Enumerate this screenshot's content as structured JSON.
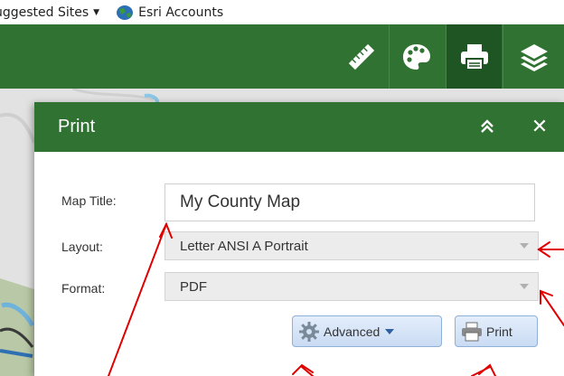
{
  "favorites_bar": {
    "suggested_sites": "uggested Sites",
    "esri_accounts": "Esri Accounts"
  },
  "toolbar": {
    "tools": [
      {
        "icon": "ruler-icon"
      },
      {
        "icon": "palette-icon"
      },
      {
        "icon": "printer-icon",
        "active": true
      },
      {
        "icon": "layers-icon"
      }
    ]
  },
  "print_panel": {
    "title": "Print",
    "map_title_label": "Map Title:",
    "map_title_value": "My County Map",
    "layout_label": "Layout:",
    "layout_value": "Letter ANSI A Portrait",
    "format_label": "Format:",
    "format_value": "PDF",
    "advanced_label": "Advanced",
    "print_label": "Print"
  },
  "colors": {
    "header_green": "#2f7232",
    "annotation_red": "#e00000",
    "button_blue": "#c9dbf3"
  }
}
